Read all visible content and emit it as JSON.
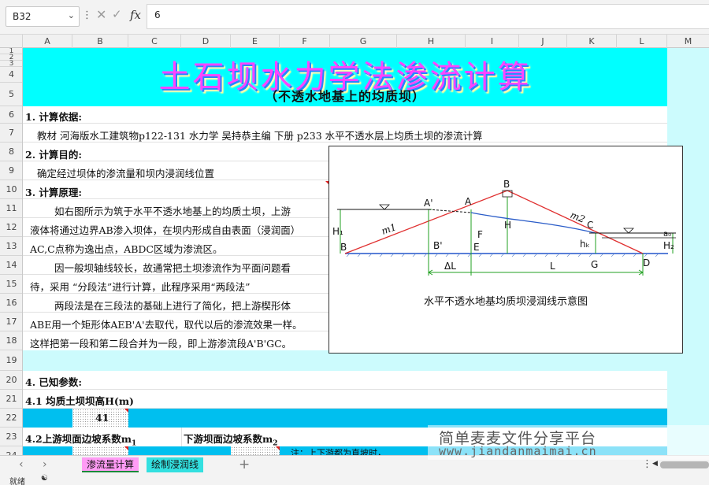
{
  "formula_bar": {
    "name_box": "B32",
    "dropdown_icon": "chevron-down-icon",
    "more_icon": "vertical-dots-icon",
    "cancel_icon": "x-icon",
    "enter_icon": "check-icon",
    "fx_label": "fx",
    "value": "6"
  },
  "columns": [
    "A",
    "B",
    "C",
    "D",
    "E",
    "F",
    "G",
    "H",
    "I",
    "J",
    "K",
    "L",
    "M"
  ],
  "rows": [
    "1",
    "2",
    "3",
    "4",
    "5",
    "6",
    "7",
    "8",
    "9",
    "10",
    "11",
    "12",
    "13",
    "14",
    "15",
    "16",
    "17",
    "18",
    "19",
    "20",
    "21",
    "22",
    "23",
    "24"
  ],
  "sheet": {
    "title": "土石坝水力学法渗流计算",
    "subtitle": "（不透水地基上的均质坝）",
    "s1_heading": "1. 计算依据:",
    "s1_text": "教材 河海版水工建筑物p122-131   水力学  吴持恭主编  下册  p233 水平不透水层上均质土坝的渗流计算",
    "s2_heading": "2. 计算目的:",
    "s2_text": "确定经过坝体的渗流量和坝内浸润线位置",
    "s3_heading": "3. 计算原理:",
    "s3_lines": [
      "如右图所示为筑于水平不透水地基上的均质土坝，上游",
      "液体将通过边界AB渗入坝体，在坝内形成自由表面（浸润面）",
      "AC,C点称为逸出点，ABDC区域为渗流区。",
      "因一般坝轴线较长，故通常把土坝渗流作为平面问题看",
      "待，采用 “分段法”进行计算，此程序采用“两段法”",
      "两段法是在三段法的基础上进行了简化，把上游楔形体",
      "ABE用一个矩形体AEB'A'去取代，取代以后的渗流效果一样。",
      "这样把第一段和第二段合并为一段，即上游渗流段A'B'GC。"
    ],
    "s4_heading": "4. 已知参数:",
    "s41_heading": "4.1 均质土坝坝高H(m)",
    "s41_value": "41",
    "s42_heading": "4.2上游坝面边坡系数m",
    "s42_sub": "1",
    "s43_heading": "下游坝面边坡系数m",
    "s43_sub": "2",
    "row24_note": "注：上下游都为直坡时，"
  },
  "diagram": {
    "caption": "水平不透水地基均质坝浸润线示意图",
    "labels": {
      "A_prime": "A'",
      "A": "A",
      "B_top": "B",
      "C": "C",
      "D": "D",
      "B_left": "B",
      "B_prime": "B'",
      "E": "E",
      "F": "F",
      "G": "G",
      "H": "H",
      "H1": "H₁",
      "H2": "H₂",
      "hk": "hₖ",
      "a0": "a₀",
      "m1": "m1",
      "m2": "m2",
      "dL": "ΔL",
      "L": "L"
    },
    "colors": {
      "dam": "#e03030",
      "construct": "#22a022",
      "phreatic": "#2a5cc8",
      "base": "#2255cc"
    }
  },
  "tabs": [
    {
      "label": "渗流量计算",
      "color": "#ff9cf5"
    },
    {
      "label": "绘制浸润线",
      "color": "#33e0e0"
    }
  ],
  "tab_add_icon": "plus-icon",
  "tab_nav": {
    "prev": "chevron-left-icon",
    "next": "chevron-right-icon"
  },
  "status": {
    "text": "就绪",
    "icon": "accessibility-icon"
  },
  "watermark": {
    "cn": "简单麦麦文件分享平台",
    "url": "www.jiandanmaimai.cn"
  },
  "colors": {
    "cyan": "#00ffff",
    "deep_cyan": "#00bfef",
    "light_cyan": "#ccfbfd"
  }
}
